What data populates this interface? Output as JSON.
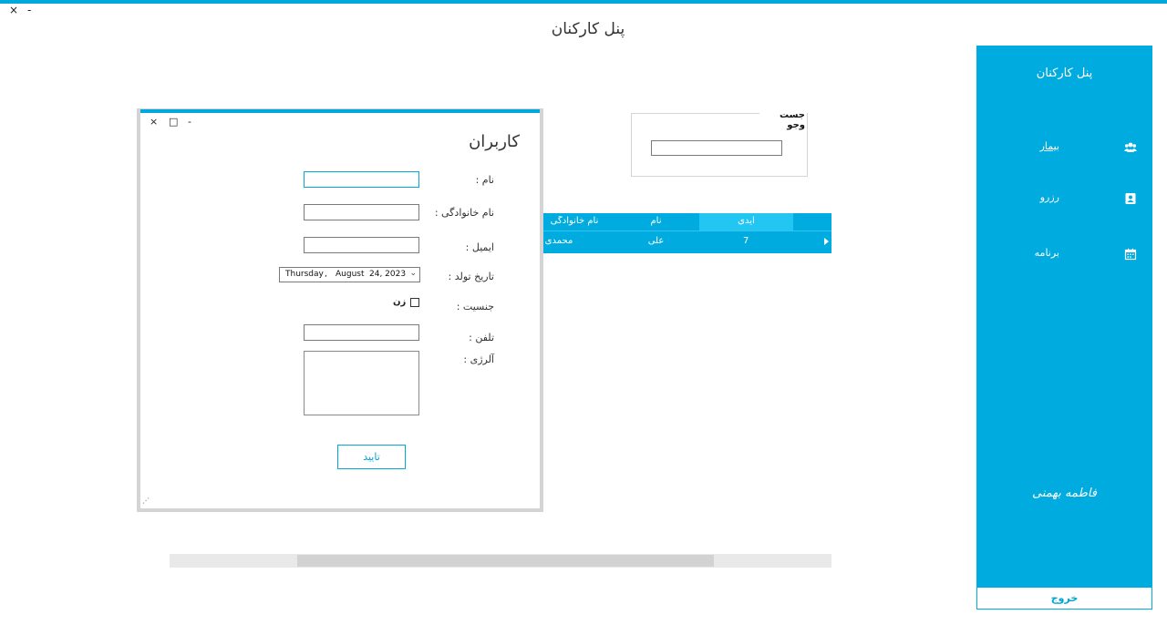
{
  "window": {
    "title": "پنل کارکنان",
    "close_glyph": "×",
    "min_glyph": "-"
  },
  "sidebar": {
    "title": "پنل کارکنان",
    "items": [
      {
        "label": "بیمار",
        "icon": "users-icon"
      },
      {
        "label": "رزرو",
        "icon": "contact-card-icon"
      },
      {
        "label": "برنامه",
        "icon": "calendar-icon"
      }
    ],
    "user_name": "فاطمه بهمنی",
    "logout_label": "خروج"
  },
  "search": {
    "legend": "جست وجو",
    "value": ""
  },
  "grid": {
    "columns": [
      "آیدی",
      "نام",
      "نام خانوادگی"
    ],
    "rows": [
      [
        "7",
        "علی",
        "محمدی"
      ]
    ]
  },
  "dialog": {
    "title": "کاربران",
    "close_glyph": "×",
    "max_glyph": "□",
    "min_glyph": "-",
    "fields": {
      "first_name_label": "نام :",
      "last_name_label": "نام خانوادگی :",
      "email_label": "ایمیل :",
      "birthdate_label": "تاریخ تولد :",
      "gender_label": "جنسیت :",
      "phone_label": "تلفن :",
      "allergy_label": "آلرژی :"
    },
    "birthdate": {
      "weekday": "Thursday",
      "sep": ",",
      "month": "August",
      "day": "24, 2023"
    },
    "gender_option": "زن",
    "gender_checked": false,
    "submit_label": "تایید",
    "grip_glyph": "⋰"
  },
  "colors": {
    "accent": "#00acdf",
    "accent_light": "#21c6f3"
  }
}
